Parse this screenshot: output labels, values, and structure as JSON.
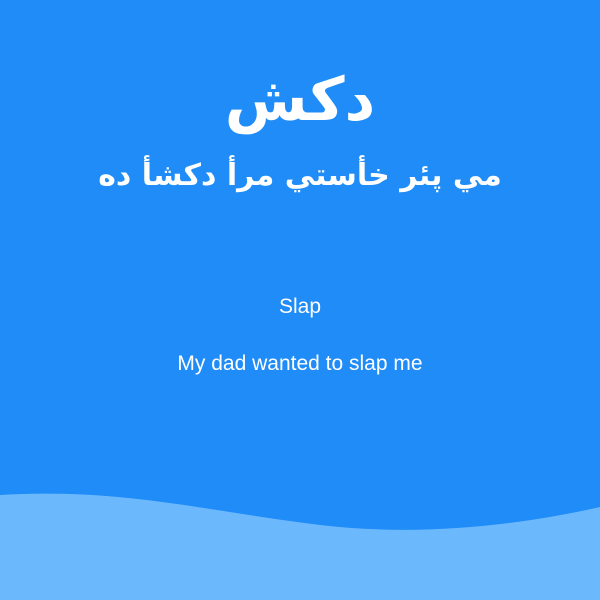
{
  "card": {
    "word": "دكش",
    "sentence": "مي پئر خأستي مرأ دكشأ ده",
    "translation_word": "Slap",
    "translation_sentence": "My dad wanted to slap me"
  },
  "colors": {
    "background": "#1f8cf7",
    "wave": "#6cb8fd",
    "text": "#ffffff"
  }
}
